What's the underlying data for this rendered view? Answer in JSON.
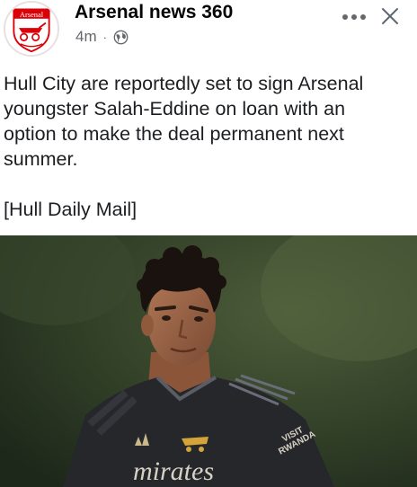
{
  "post": {
    "page_name": "Arsenal news 360",
    "avatar_text": "Arsenal",
    "time_ago": "4m",
    "separator": "·",
    "audience_icon": "globe-icon",
    "menu_icon": "more-horizontal-icon",
    "close_icon": "close-icon",
    "body": "Hull City are reportedly set to sign Arsenal\nyoungster Salah-Eddine on loan with an\noption to make the deal permanent next\nsummer.\n\n[Hull Daily Mail]",
    "photo": {
      "description": "player-photo",
      "shirt_sponsor": "mirates",
      "sleeve_text_1": "VISIT",
      "sleeve_text_2": "RWANDA"
    }
  },
  "colors": {
    "text": "#1c1e21",
    "muted": "#65676b",
    "arsenal_red": "#db0007"
  }
}
